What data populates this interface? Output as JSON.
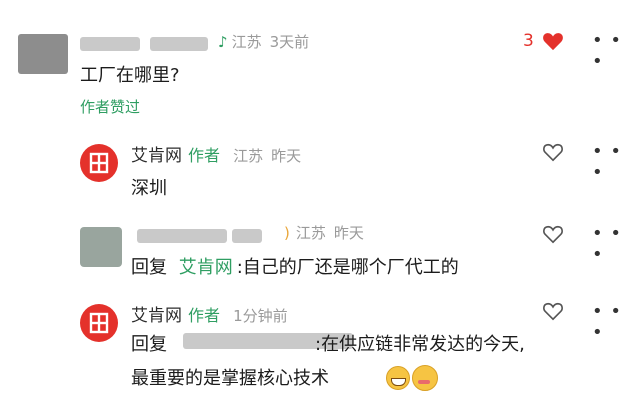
{
  "comments": {
    "top": {
      "location": "江苏",
      "time": "3天前",
      "text": "工厂在哪里?",
      "author_liked": "作者赞过",
      "like_count": "3"
    },
    "reply1": {
      "user": "艾肯网",
      "author_tag": "作者",
      "location": "江苏",
      "time": "昨天",
      "text": "深圳"
    },
    "reply2": {
      "location": "江苏",
      "time": "昨天",
      "reply_prefix": "回复",
      "reply_to": "艾肯网",
      "text": ":自己的厂还是哪个厂代工的"
    },
    "reply3": {
      "user": "艾肯网",
      "author_tag": "作者",
      "time": "1分钟前",
      "reply_prefix": "回复",
      "text_line1": ":在供应链非常发达的今天,",
      "text_line2": "最重要的是掌握核心技术"
    }
  },
  "icons": {
    "like": "heart-icon",
    "more": "more-dots-icon",
    "brand_color": "#e4312b",
    "accent_green": "#2f9e62"
  }
}
